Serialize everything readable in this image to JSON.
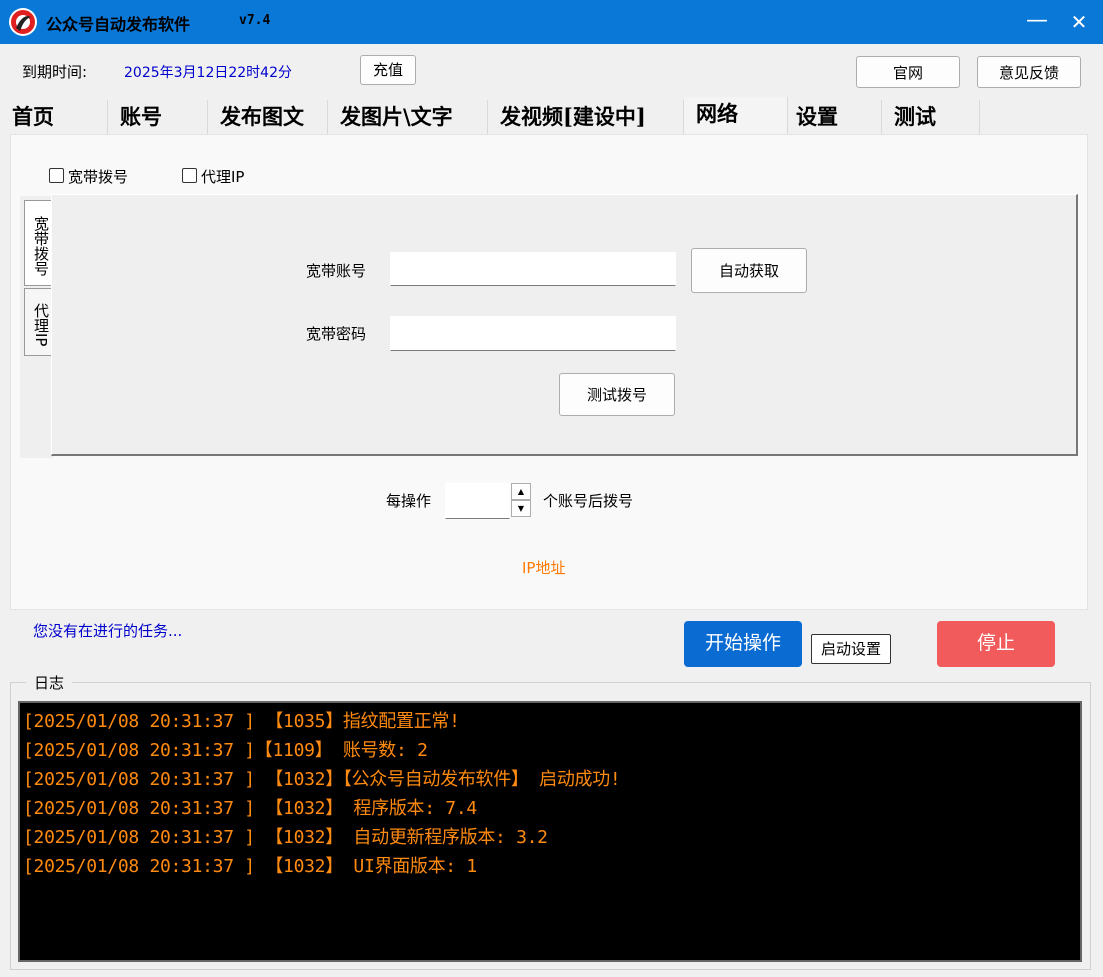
{
  "window": {
    "title": "公众号自动发布软件",
    "version": "v7.4",
    "minimize_glyph": "—",
    "close_glyph": "✕"
  },
  "header": {
    "expire_label": "到期时间:",
    "expire_value": "2025年3月12日22时42分",
    "recharge_label": "充值",
    "website_label": "官网",
    "feedback_label": "意见反馈"
  },
  "tabs": [
    {
      "label": "首页"
    },
    {
      "label": "账号"
    },
    {
      "label": "发布图文"
    },
    {
      "label": "发图片\\文字"
    },
    {
      "label": "发视频[建设中]"
    },
    {
      "label": "网络",
      "active": true
    },
    {
      "label": "设置"
    },
    {
      "label": "测试"
    }
  ],
  "network": {
    "checkbox_dial": "宽带拨号",
    "checkbox_proxy": "代理IP",
    "side_tabs": [
      "宽带拨号",
      "代理IP"
    ],
    "account_label": "宽带账号",
    "account_value": "",
    "autofetch_label": "自动获取",
    "password_label": "宽带密码",
    "password_value": "",
    "testdial_label": "测试拨号",
    "per_op_label": "每操作",
    "per_op_value": "",
    "per_op_suffix": "个账号后拨号",
    "ip_label": "IP地址"
  },
  "status": {
    "task_text": "您没有在进行的任务...",
    "start_label": "开始操作",
    "startup_settings_label": "启动设置",
    "stop_label": "停止"
  },
  "log": {
    "legend": "日志",
    "lines": [
      "[2025/01/08 20:31:37 ] 【1035】指纹配置正常!",
      "[2025/01/08 20:31:37 ]【1109】 账号数: 2",
      "[2025/01/08 20:31:37 ] 【1032】【公众号自动发布软件】 启动成功!",
      "[2025/01/08 20:31:37 ] 【1032】 程序版本: 7.4",
      "[2025/01/08 20:31:37 ] 【1032】 自动更新程序版本: 3.2",
      "[2025/01/08 20:31:37 ] 【1032】 UI界面版本: 1"
    ]
  },
  "colors": {
    "titlebar": "#0a78d7",
    "link_blue": "#0000cc",
    "log_text": "#ff8a10",
    "start_button": "#0a6bd2",
    "stop_button": "#f15b5b"
  }
}
